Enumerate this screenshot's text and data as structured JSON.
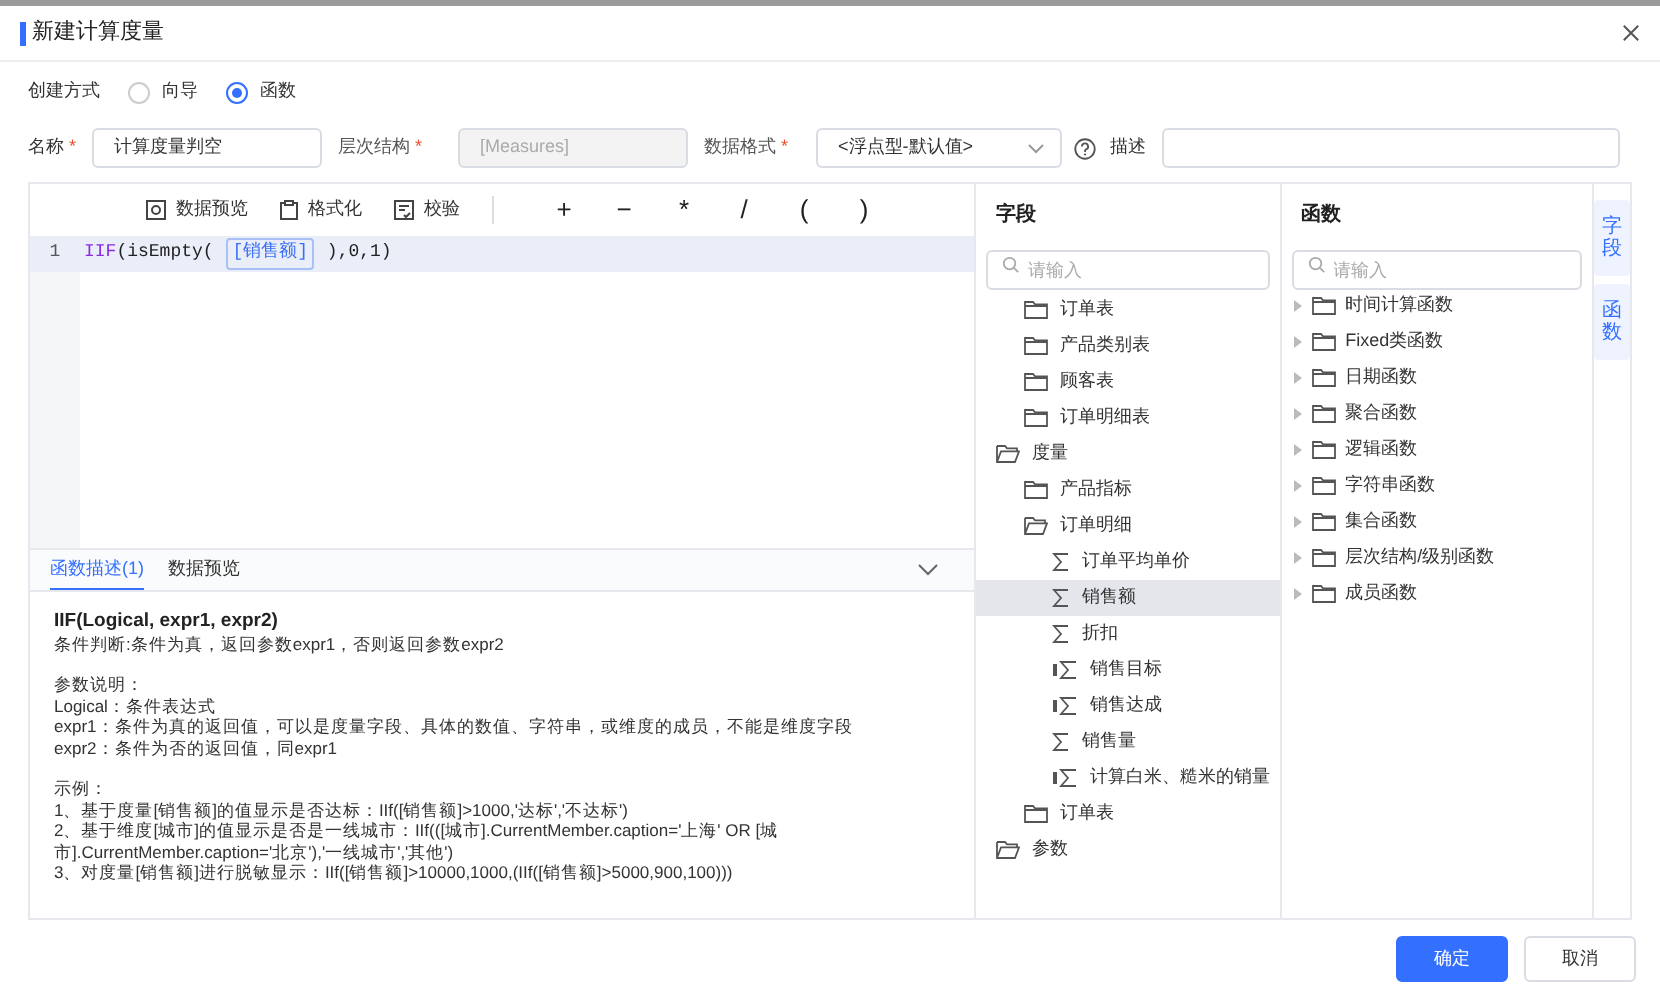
{
  "dialog": {
    "title": "新建计算度量"
  },
  "create_mode": {
    "label": "创建方式",
    "options": [
      {
        "label": "向导",
        "selected": false
      },
      {
        "label": "函数",
        "selected": true
      }
    ]
  },
  "form": {
    "name": {
      "label": "名称",
      "value": "计算度量判空"
    },
    "hierarchy": {
      "label": "层次结构",
      "value": "[Measures]",
      "disabled": true
    },
    "format": {
      "label": "数据格式",
      "value": "<浮点型-默认值>"
    },
    "description": {
      "label": "描述"
    }
  },
  "toolbar": [
    {
      "label": "数据预览",
      "kind": "preview"
    },
    {
      "label": "格式化",
      "kind": "format"
    },
    {
      "label": "校验",
      "kind": "check"
    }
  ],
  "operators": [
    "+",
    "−",
    "*",
    "/",
    "(",
    ")"
  ],
  "code": {
    "line_number": "1",
    "tokens": [
      {
        "text": "IIF",
        "kind": "keyword"
      },
      {
        "text": "(isEmpty( ",
        "kind": "plain"
      },
      {
        "text": "[销售额]",
        "kind": "field"
      },
      {
        "text": " ),0,1)",
        "kind": "plain"
      }
    ]
  },
  "bottom_tabs": [
    {
      "label": "函数描述(1)",
      "selected": true
    },
    {
      "label": "数据预览",
      "selected": false
    }
  ],
  "function_doc": {
    "signature": "IIF(Logical, expr1, expr2)",
    "paragraphs": [
      [
        "条件判断:条件为真，返回参数expr1，否则返回参数expr2"
      ],
      [
        "参数说明：",
        "Logical：条件表达式",
        "expr1：条件为真的返回值，可以是度量字段、具体的数值、字符串，或维度的成员，不能是维度字段",
        "expr2：条件为否的返回值，同expr1"
      ],
      [
        "示例：",
        "1、基于度量[销售额]的值显示是否达标：IIf([销售额]>1000,'达标','不达标')",
        "2、基于维度[城市]的值显示是否是一线城市：IIf(([城市].CurrentMember.caption='上海' OR [城市].CurrentMember.caption='北京'),'一线城市','其他')",
        "3、对度量[销售额]进行脱敏显示：IIf([销售额]>10000,1000,(IIf([销售额]>5000,900,100)))"
      ]
    ]
  },
  "fields_panel": {
    "title": "字段",
    "search": {
      "placeholder": "请输入"
    },
    "tree": [
      {
        "children": [
          {
            "label": "订单表",
            "kind": "folder",
            "expanded": false,
            "selected": false
          },
          {
            "label": "产品类别表",
            "kind": "folder",
            "expanded": false,
            "selected": false
          },
          {
            "label": "顾客表",
            "kind": "folder",
            "expanded": false,
            "selected": false
          },
          {
            "label": "订单明细表",
            "kind": "folder",
            "expanded": false,
            "selected": false
          }
        ]
      },
      {
        "label": "度量",
        "kind": "folder",
        "expanded": true,
        "selected": false,
        "children": [
          {
            "label": "产品指标",
            "kind": "folder",
            "expanded": false,
            "selected": false
          },
          {
            "label": "订单明细",
            "kind": "folder",
            "expanded": true,
            "selected": false,
            "children": [
              {
                "label": "订单平均单价",
                "kind": "measure",
                "selected": false
              },
              {
                "label": "销售额",
                "kind": "measure",
                "selected": true
              },
              {
                "label": "折扣",
                "kind": "measure",
                "selected": false
              },
              {
                "label": "销售目标",
                "kind": "calculated",
                "selected": false
              },
              {
                "label": "销售达成",
                "kind": "calculated",
                "selected": false
              },
              {
                "label": "销售量",
                "kind": "measure",
                "selected": false
              },
              {
                "label": "计算白米、糙米的销量",
                "kind": "calculated",
                "selected": false
              }
            ]
          },
          {
            "label": "订单表",
            "kind": "folder",
            "expanded": false,
            "selected": false
          }
        ]
      },
      {
        "label": "参数",
        "kind": "folder",
        "expanded": true,
        "selected": false
      }
    ]
  },
  "functions_panel": {
    "title": "函数",
    "search": {
      "placeholder": "请输入"
    },
    "items": [
      "时间计算函数",
      "Fixed类函数",
      "日期函数",
      "聚合函数",
      "逻辑函数",
      "字符串函数",
      "集合函数",
      "层次结构/级别函数",
      "成员函数"
    ]
  },
  "side_tabs": [
    "字段",
    "函数"
  ],
  "buttons": [
    {
      "label": "确定",
      "kind": "primary"
    },
    {
      "label": "取消",
      "kind": "default"
    }
  ]
}
